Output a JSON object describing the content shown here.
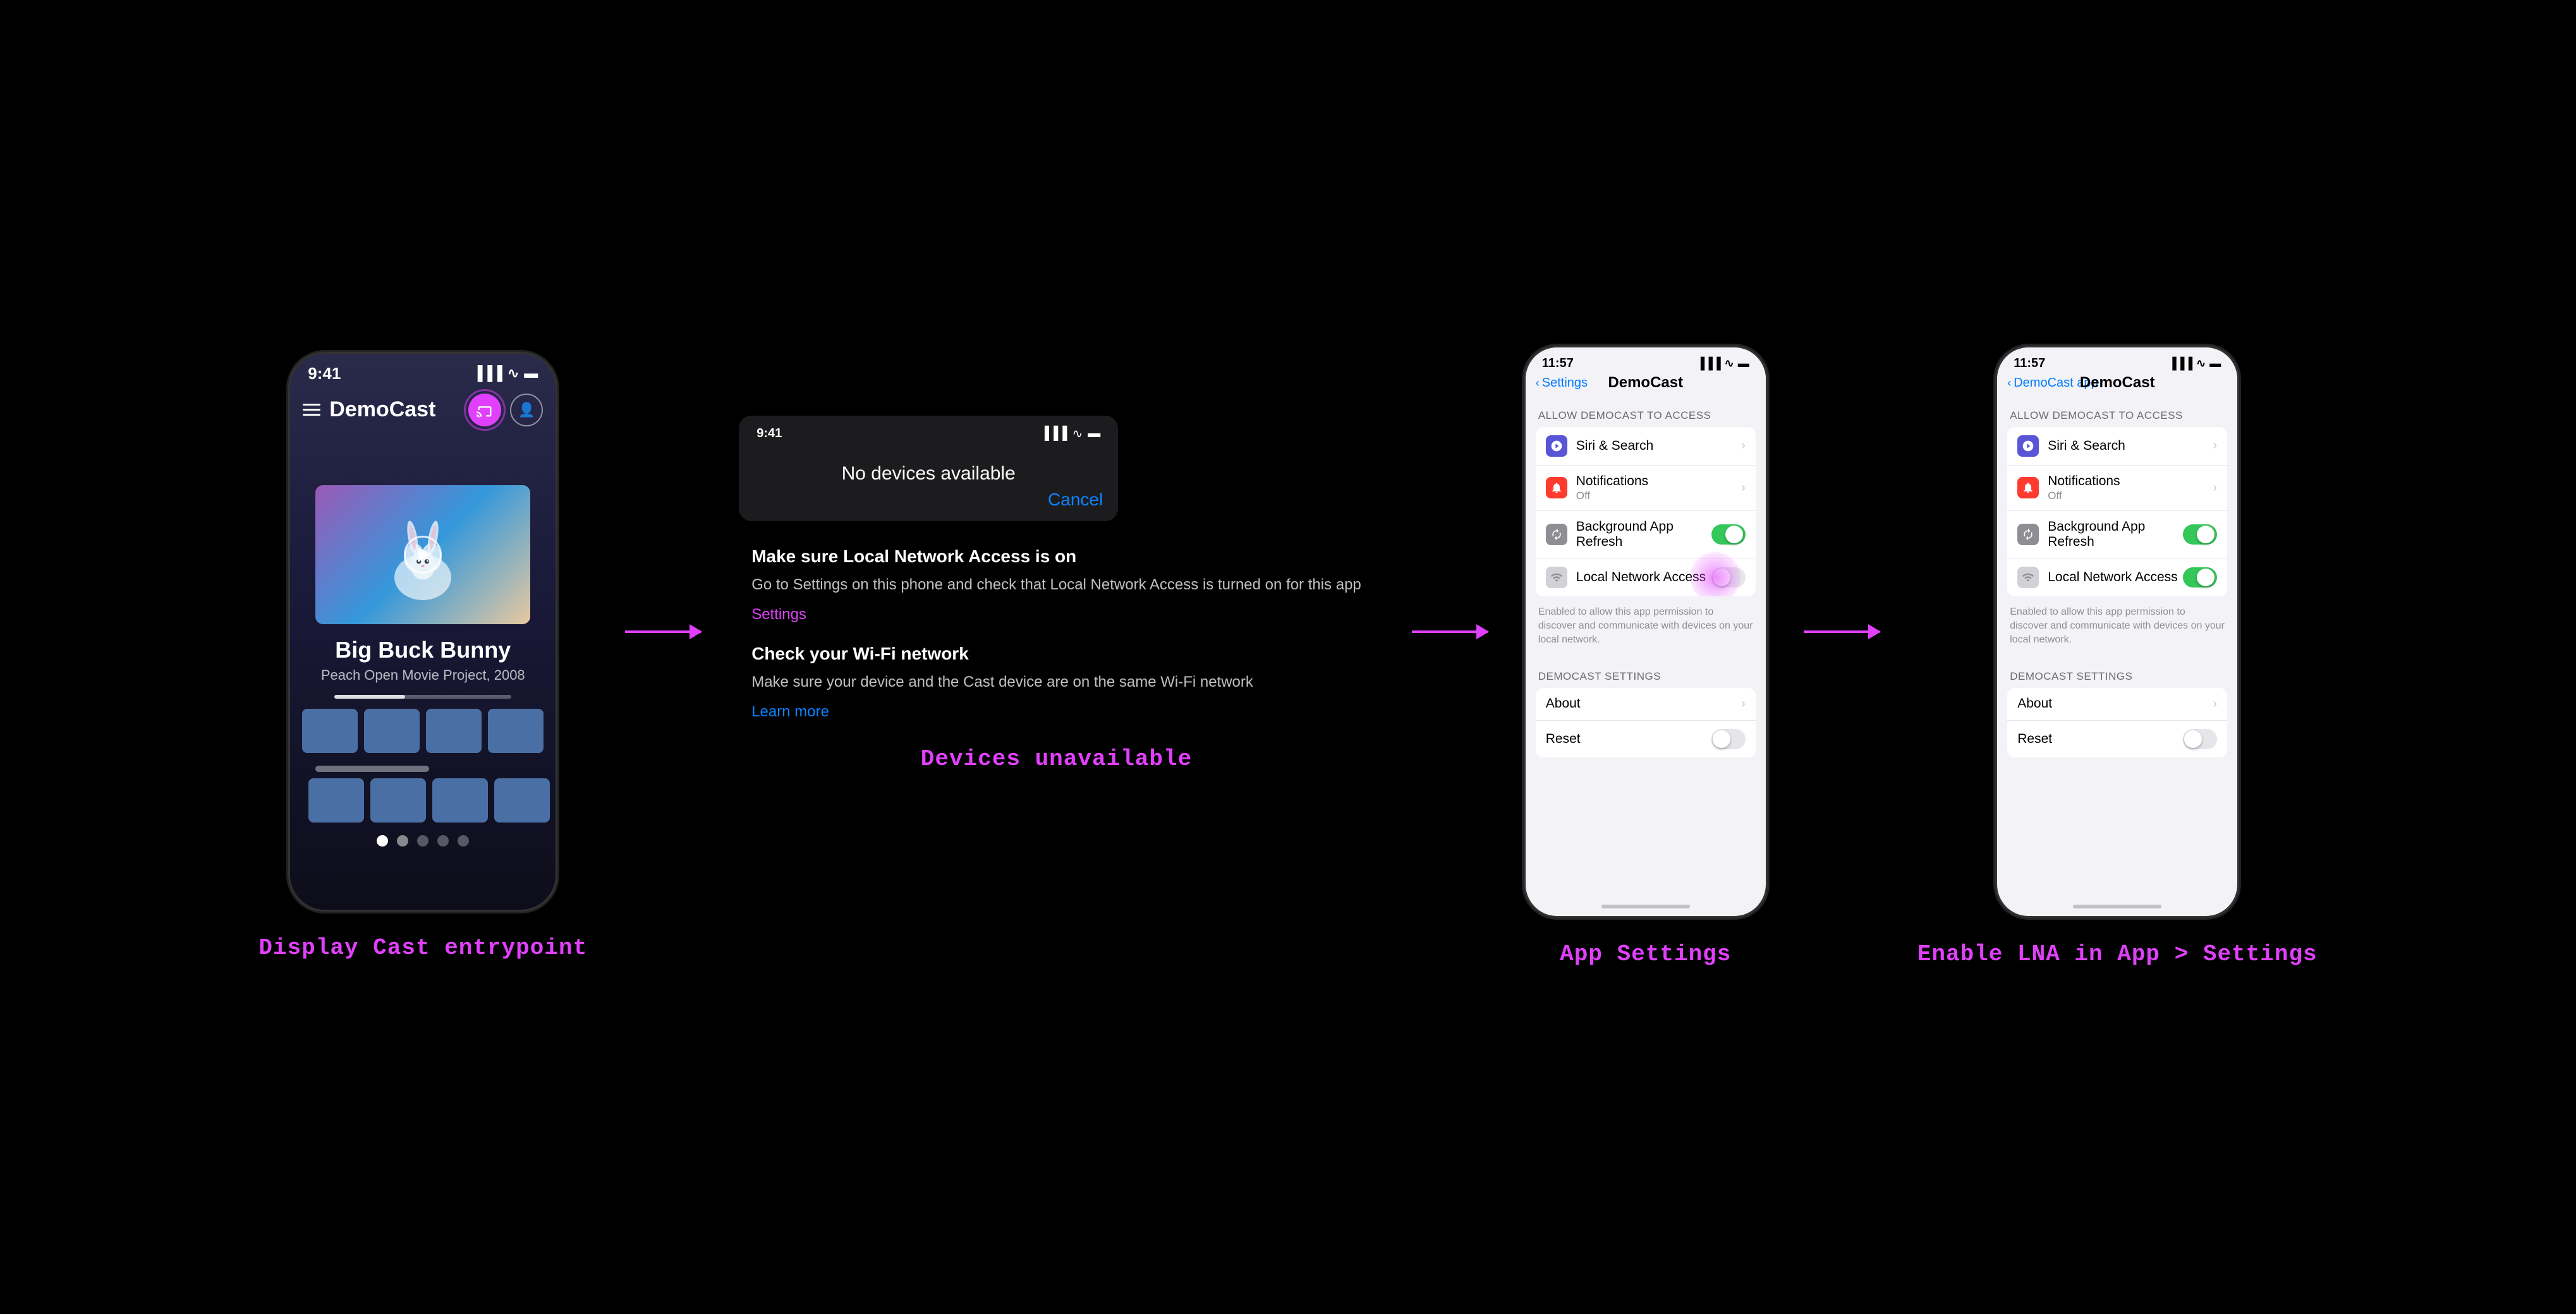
{
  "sections": {
    "s1": {
      "label": "Display Cast entrypoint",
      "phone": {
        "time": "9:41",
        "app_title": "DemoCast",
        "movie_title": "Big Buck Bunny",
        "movie_subtitle": "Peach Open Movie Project, 2008"
      }
    },
    "s2": {
      "label": "Devices unavailable",
      "no_devices_title": "No devices available",
      "cancel_label": "Cancel",
      "trouble1_title": "Make sure Local Network Access is on",
      "trouble1_text": "Go to Settings on this phone and check that Local Network Access is turned on for this app",
      "trouble1_link": "Settings",
      "trouble2_title": "Check your Wi-Fi network",
      "trouble2_text": "Make sure your device and the Cast device are on the same Wi-Fi network",
      "trouble2_link": "Learn more"
    },
    "s3": {
      "label": "App Settings",
      "time": "11:57",
      "back_label": "Settings",
      "page_title": "DemoCast",
      "section_header": "ALLOW DEMOCAST TO ACCESS",
      "rows": [
        {
          "label": "Siri & Search",
          "sublabel": "",
          "icon_type": "purple",
          "has_chevron": true,
          "toggle": null
        },
        {
          "label": "Notifications",
          "sublabel": "Off",
          "icon_type": "red",
          "has_chevron": true,
          "toggle": null
        },
        {
          "label": "Background App Refresh",
          "sublabel": "",
          "icon_type": "gray",
          "has_chevron": false,
          "toggle": "on"
        },
        {
          "label": "Local Network Access",
          "sublabel": "",
          "icon_type": "light-gray",
          "has_chevron": false,
          "toggle": "off",
          "animated": true
        }
      ],
      "footer_text": "Enabled to allow this app permission to discover and communicate with devices on your local network.",
      "settings_section": "DEMOCAST SETTINGS",
      "settings_rows": [
        {
          "label": "About",
          "has_chevron": true,
          "toggle": null
        },
        {
          "label": "Reset",
          "has_chevron": false,
          "toggle": "off"
        }
      ]
    },
    "s4": {
      "label": "Enable LNA in App > Settings",
      "time": "11:57",
      "back_label": "DemoCast app",
      "page_title": "DemoCast",
      "section_header": "ALLOW DEMOCAST TO ACCESS",
      "rows": [
        {
          "label": "Siri & Search",
          "sublabel": "",
          "icon_type": "purple",
          "has_chevron": true,
          "toggle": null
        },
        {
          "label": "Notifications",
          "sublabel": "Off",
          "icon_type": "red",
          "has_chevron": true,
          "toggle": null
        },
        {
          "label": "Background App Refresh",
          "sublabel": "",
          "icon_type": "gray",
          "has_chevron": false,
          "toggle": "on"
        },
        {
          "label": "Local Network Access",
          "sublabel": "",
          "icon_type": "light-gray",
          "has_chevron": false,
          "toggle": "on"
        }
      ],
      "footer_text": "Enabled to allow this app permission to discover and communicate with devices on your local network.",
      "settings_section": "DEMOCAST SETTINGS",
      "settings_rows": [
        {
          "label": "About",
          "has_chevron": true,
          "toggle": null
        },
        {
          "label": "Reset",
          "has_chevron": false,
          "toggle": "off"
        }
      ]
    }
  }
}
